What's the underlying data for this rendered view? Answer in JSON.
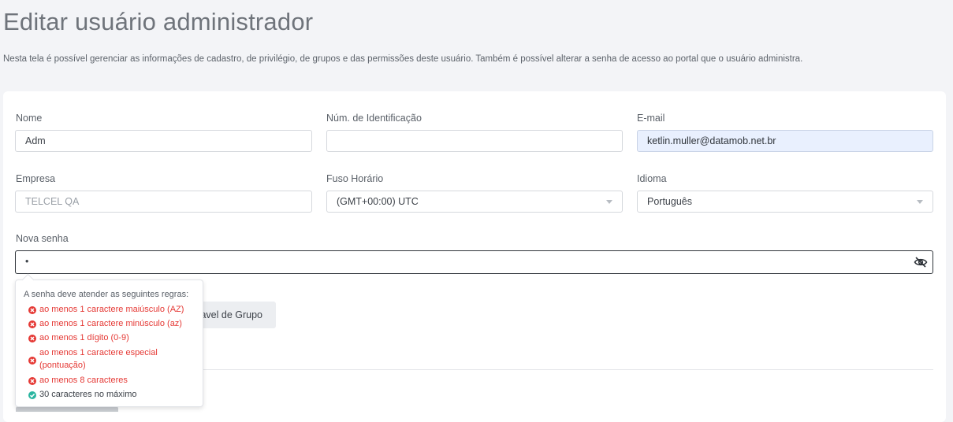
{
  "page": {
    "title": "Editar usuário administrador",
    "description": "Nesta tela é possível gerenciar as informações de cadastro, de privilégio, de grupos e das permissões deste usuário. Também é possível alterar a senha de acesso ao portal que o usuário administra."
  },
  "form": {
    "nome": {
      "label": "Nome",
      "value": "Adm"
    },
    "identificacao": {
      "label": "Núm. de Identificação",
      "value": ""
    },
    "email": {
      "label": "E-mail",
      "value": "ketlin.muller@datamob.net.br"
    },
    "empresa": {
      "label": "Empresa",
      "value": "TELCEL QA"
    },
    "fuso": {
      "label": "Fuso Horário",
      "value": "(GMT+00:00) UTC"
    },
    "idioma": {
      "label": "Idioma",
      "value": "Português"
    },
    "senha": {
      "label": "Nova senha",
      "value": "•"
    }
  },
  "group_button": {
    "label": "avel de Grupo"
  },
  "password_rules": {
    "title": "A senha deve atender as seguintes regras:",
    "rules": [
      {
        "text": "ao menos 1 caractere maiúsculo (AZ)",
        "status": "fail"
      },
      {
        "text": "ao menos 1 caractere minúsculo (az)",
        "status": "fail"
      },
      {
        "text": "ao menos 1 dígito (0-9)",
        "status": "fail"
      },
      {
        "text": "ao menos 1 caractere especial",
        "text2": "(pontuação)",
        "status": "fail"
      },
      {
        "text": "ao menos 8 caracteres",
        "status": "fail"
      },
      {
        "text": "30 caracteres no máximo",
        "status": "pass"
      }
    ]
  },
  "icons": {
    "eye": "eye-off-icon",
    "fail": "x-circle-icon",
    "pass": "check-circle-icon"
  },
  "colors": {
    "fail": "#e53935",
    "pass": "#2bb5a0",
    "autofill": "#e9f0fe"
  }
}
